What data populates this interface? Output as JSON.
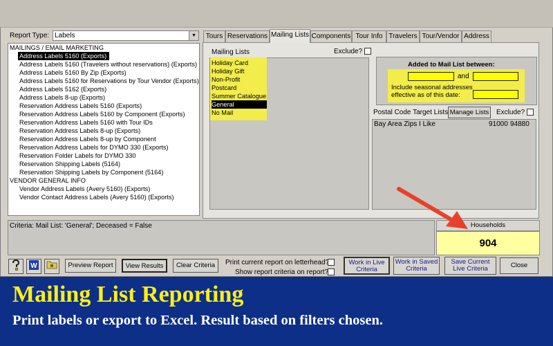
{
  "report_type": {
    "label": "Report Type:",
    "value": "Labels"
  },
  "report_list": [
    {
      "text": "MAILINGS / EMAIL MARKETING",
      "kind": "group"
    },
    {
      "text": "Address Labels 5160 (Exports)",
      "kind": "item",
      "selected": true
    },
    {
      "text": "Address Labels 5160 (Travelers without reservations) (Exports)",
      "kind": "item"
    },
    {
      "text": "Address Labels 5160 By Zip (Exports)",
      "kind": "item"
    },
    {
      "text": "Address Labels 5160 for Reservations by Tour Vendor (Exports)",
      "kind": "item"
    },
    {
      "text": "Address Labels 5162 (Exports)",
      "kind": "item"
    },
    {
      "text": "Address Labels 8-up (Exports)",
      "kind": "item"
    },
    {
      "text": "Reservation Address Labels 5160 (Exports)",
      "kind": "item"
    },
    {
      "text": "Reservation Address Labels 5160 by Component (Exports)",
      "kind": "item"
    },
    {
      "text": "Reservation Address Labels 5160 with Tour IDs",
      "kind": "item"
    },
    {
      "text": "Reservation Address Labels 8-up (Exports)",
      "kind": "item"
    },
    {
      "text": "Reservation Address Labels 8-up by Component",
      "kind": "item"
    },
    {
      "text": "Reservation Address Labels for DYMO 330 (Exports)",
      "kind": "item"
    },
    {
      "text": "Reservation Folder Labels for DYMO 330",
      "kind": "item"
    },
    {
      "text": "Reservation Shipping Labels (5164)",
      "kind": "item"
    },
    {
      "text": "Reservation Shipping Labels by Component (5164)",
      "kind": "item"
    },
    {
      "text": "VENDOR GENERAL INFO",
      "kind": "group"
    },
    {
      "text": "Vendor Address Labels (Avery 5160) (Exports)",
      "kind": "item"
    },
    {
      "text": "Vendor Contact Address Labels (Avery 5160) (Exports)",
      "kind": "item"
    }
  ],
  "tabs": [
    "Tours",
    "Reservations",
    "Mailing Lists",
    "Components",
    "Tour Info",
    "Travelers",
    "Tour/Vendor",
    "Address"
  ],
  "active_tab": "Mailing Lists",
  "mailing_lists": {
    "label": "Mailing Lists",
    "exclude_label": "Exclude?",
    "items": [
      "Holiday Card",
      "Holiday Gift",
      "Non-Profit",
      "Postcard",
      "Summer Catalogue",
      "General",
      "No Mail"
    ],
    "selected": "General",
    "highlight_color": "#f2ed4a"
  },
  "added": {
    "title": "Added to Mail List between:",
    "and_label": "and",
    "seasonal_line1": "Include seasonal addresses",
    "seasonal_line2": "effective as of this date:"
  },
  "postal": {
    "label": "Postal Code Target Lists",
    "manage_button": "Manage Lists",
    "exclude_label": "Exclude?",
    "row": {
      "name": "Bay Area Zips I Like",
      "from": "91000",
      "to": "94880"
    }
  },
  "criteria_text": "Criteria: Mail List: 'General'; Deceased = False",
  "households": {
    "label": "Households",
    "value": "904"
  },
  "icons": [
    "help-icon",
    "word-icon",
    "folder-icon"
  ],
  "buttons": {
    "preview": "Preview Report",
    "view": "View Results",
    "clear": "Clear Criteria",
    "print_letterhead": "Print current report on letterhead?",
    "show_criteria": "Show report criteria on report?",
    "live_line1": "Work in Live",
    "live_line2": "Criteria",
    "saved_line1": "Work in Saved",
    "saved_line2": "Criteria",
    "save_line1": "Save Current",
    "save_line2": "Live Criteria",
    "close": "Close"
  },
  "banner": {
    "title": "Mailing List Reporting",
    "subtitle": "Print labels or export to Excel. Result based on filters chosen."
  },
  "colors": {
    "banner": "#0d2f87",
    "banner_title": "#ffee1a",
    "arrow": "#e8412b",
    "households_bg": "#ffffa0"
  }
}
